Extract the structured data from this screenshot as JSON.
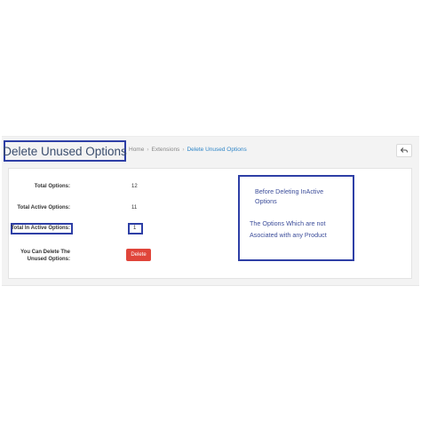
{
  "header": {
    "title": "Delete Unused Options",
    "breadcrumb": [
      "Home",
      "Extensions",
      "Delete Unused Options"
    ],
    "breadcrumb_separator": "›",
    "back_icon": "reply-arrow-icon"
  },
  "stats": {
    "total_options": {
      "label": "Total Options:",
      "value": "12"
    },
    "total_active_options": {
      "label": "Total Active Options:",
      "value": "11"
    },
    "total_inactive_options": {
      "label": "Total In Active Options:",
      "value": "1"
    },
    "delete_hint": {
      "label_line1": "You Can Delete The",
      "label_line2": "Unused Options:"
    }
  },
  "actions": {
    "delete_label": "Delete"
  },
  "annotation": {
    "line1": "Before Deleting InActive",
    "line2": "Options",
    "line3": "The Options Which are not",
    "line4": "Asociated with any Product"
  },
  "colors": {
    "highlight_border": "#2e3fa6",
    "delete_button": "#e0453a",
    "link": "#2f86c8",
    "annotation_text": "#3c4d9a"
  }
}
